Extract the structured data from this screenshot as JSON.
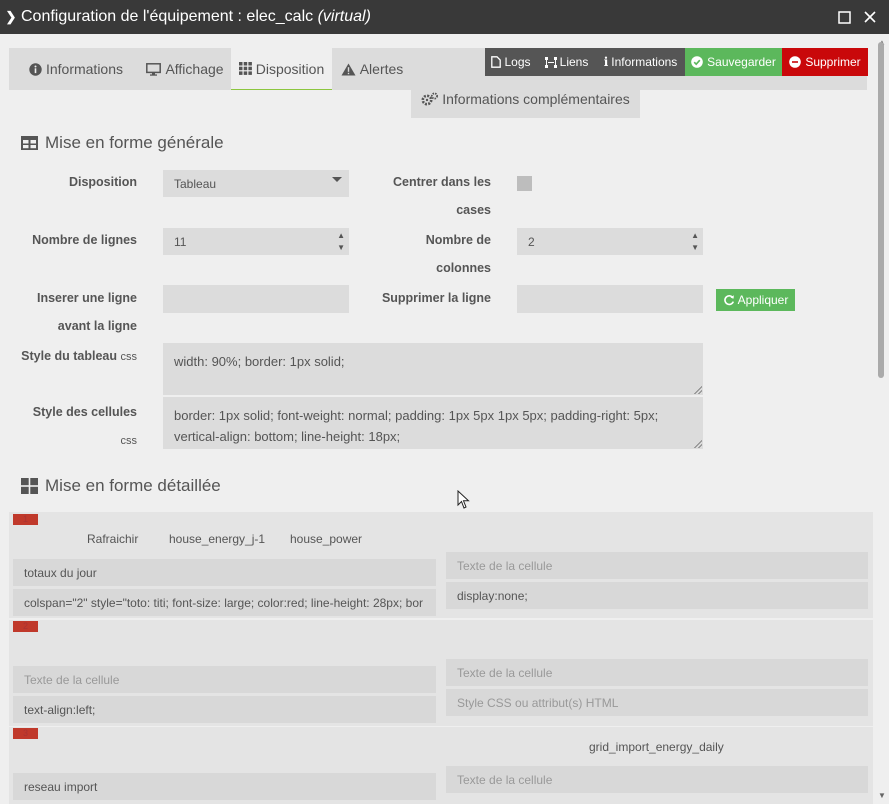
{
  "window": {
    "title_prefix": "Configuration de l'équipement : elec_calc ",
    "title_suffix": "(virtual)"
  },
  "tabs": [
    {
      "label": "Informations",
      "icon": "info-circle-icon"
    },
    {
      "label": "Affichage",
      "icon": "monitor-icon"
    },
    {
      "label": "Disposition",
      "icon": "grid-icon"
    },
    {
      "label": "Alertes",
      "icon": "warning-icon"
    }
  ],
  "actions": {
    "logs": "Logs",
    "liens": "Liens",
    "informations": "Informations",
    "sauvegarder": "Sauvegarder",
    "supprimer": "Supprimer",
    "infos_comp": "Informations complémentaires"
  },
  "colors": {
    "green": "#5cb85c",
    "save_green": "#4cae4c",
    "red": "#c9080a",
    "dark": "#393939",
    "tab_active_line": "#8cc63f"
  },
  "general": {
    "title": "Mise en forme générale",
    "disposition_label": "Disposition",
    "disposition_value": "Tableau",
    "centrer_label_1": "Centrer dans les",
    "centrer_label_2": "cases",
    "lignes_label": "Nombre de lignes",
    "lignes_value": "11",
    "colonnes_label_1": "Nombre de",
    "colonnes_label_2": "colonnes",
    "colonnes_value": "2",
    "inserer_label_1": "Inserer une ligne",
    "inserer_label_2": "avant la ligne",
    "supprimer_label": "Supprimer la ligne",
    "appliquer": "Appliquer",
    "style_tableau_label": "Style du tableau",
    "style_cellules_label": "Style des cellules",
    "css": "css",
    "style_tableau_value": "width: 90%; border: 1px solid;",
    "style_cellules_value": "border: 1px solid; font-weight: normal; padding: 1px 5px 1px 5px; padding-right: 5px; vertical-align: bottom; line-height: 18px;"
  },
  "detail": {
    "title": "Mise en forme détaillée",
    "row1": {
      "tag": "1",
      "cmd1": "Rafraichir",
      "cmd2": "house_energy_j-1",
      "cmd3": "house_power",
      "c1_text": "totaux du jour",
      "c1_css": "colspan=\"2\" style=\"toto: titi; font-size: large; color:red; line-height: 28px; bor",
      "c2_text_ph": "Texte de la cellule",
      "c2_css": "display:none;"
    },
    "row2": {
      "tag": "2",
      "c1_text_ph": "Texte de la cellule",
      "c1_css": "text-align:left;",
      "c2_text_ph": "Texte de la cellule",
      "c2_css_ph": "Style CSS ou attribut(s) HTML"
    },
    "row3": {
      "tag": "3",
      "cmd": "grid_import_energy_daily",
      "c1_text": "reseau import",
      "c2_text_ph": "Texte de la cellule"
    }
  }
}
